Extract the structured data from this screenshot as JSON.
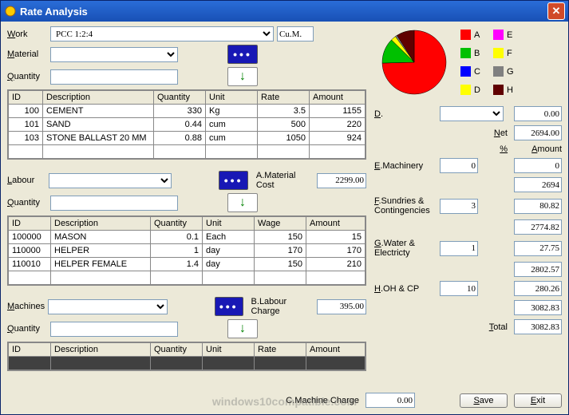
{
  "window": {
    "title": "Rate Analysis"
  },
  "labels": {
    "work": "Work",
    "material": "Material",
    "quantity": "Quantity",
    "labour": "Labour",
    "machines": "Machines",
    "material_cost": "A.Material Cost",
    "labour_charge": "B.Labour Charge",
    "machine_charge": "C.Machine Charge",
    "net": "Net",
    "percent": "%",
    "amount": "Amount",
    "d": "D.",
    "e": "E.Machinery",
    "f": "F.Sundries & Contingencies",
    "g": "G.Water & Electricty",
    "h": "H.OH & CP",
    "total": "Total",
    "save": "Save",
    "exit": "Exit",
    "unit_label": "Cu.M."
  },
  "work": {
    "value": "PCC 1:2:4"
  },
  "mat_table": {
    "headers": [
      "ID",
      "Description",
      "Quantity",
      "Unit",
      "Rate",
      "Amount"
    ],
    "rows": [
      {
        "id": "100",
        "desc": "CEMENT",
        "qty": "330",
        "unit": "Kg",
        "rate": "3.5",
        "amount": "1155"
      },
      {
        "id": "101",
        "desc": "SAND",
        "qty": "0.44",
        "unit": "cum",
        "rate": "500",
        "amount": "220"
      },
      {
        "id": "103",
        "desc": "STONE BALLAST 20 MM",
        "qty": "0.88",
        "unit": "cum",
        "rate": "1050",
        "amount": "924"
      }
    ]
  },
  "material_cost": "2299.00",
  "lab_table": {
    "headers": [
      "ID",
      "Description",
      "Quantity",
      "Unit",
      "Wage",
      "Amount"
    ],
    "rows": [
      {
        "id": "100000",
        "desc": "MASON",
        "qty": "0.1",
        "unit": "Each",
        "rate": "150",
        "amount": "15"
      },
      {
        "id": "110000",
        "desc": "HELPER",
        "qty": "1",
        "unit": "day",
        "rate": "170",
        "amount": "170"
      },
      {
        "id": "110010",
        "desc": "HELPER FEMALE",
        "qty": "1.4",
        "unit": "day",
        "rate": "150",
        "amount": "210"
      }
    ]
  },
  "labour_charge": "395.00",
  "mach_table": {
    "headers": [
      "ID",
      "Description",
      "Quantity",
      "Unit",
      "Rate",
      "Amount"
    ]
  },
  "machine_charge": "0.00",
  "summary": {
    "d_value": "0.00",
    "net": "2694.00",
    "e_in": "0",
    "e_out": "0",
    "sub1": "2694",
    "f_in": "3",
    "f_out": "80.82",
    "sub2": "2774.82",
    "g_in": "1",
    "g_out": "27.75",
    "sub3": "2802.57",
    "h_in": "10",
    "h_out": "280.26",
    "sub4": "3082.83",
    "total": "3082.83"
  },
  "legend": [
    {
      "label": "A",
      "color": "#ff0000"
    },
    {
      "label": "E",
      "color": "#ff00ff"
    },
    {
      "label": "B",
      "color": "#00c000"
    },
    {
      "label": "F",
      "color": "#ffff00"
    },
    {
      "label": "C",
      "color": "#0000ff"
    },
    {
      "label": "G",
      "color": "#808080"
    },
    {
      "label": "D",
      "color": "#ffff00"
    },
    {
      "label": "H",
      "color": "#600000"
    }
  ],
  "chart_data": {
    "type": "pie",
    "title": "",
    "series": [
      {
        "name": "A",
        "value": 2299.0,
        "color": "#ff0000"
      },
      {
        "name": "B",
        "value": 395.0,
        "color": "#00c000"
      },
      {
        "name": "C",
        "value": 0.0,
        "color": "#0000ff"
      },
      {
        "name": "D",
        "value": 0.0,
        "color": "#ffff00"
      },
      {
        "name": "E",
        "value": 0.0,
        "color": "#ff00ff"
      },
      {
        "name": "F",
        "value": 80.82,
        "color": "#ffff00"
      },
      {
        "name": "G",
        "value": 27.75,
        "color": "#808080"
      },
      {
        "name": "H",
        "value": 280.26,
        "color": "#600000"
      }
    ]
  },
  "watermark": "windows10compatible.com"
}
